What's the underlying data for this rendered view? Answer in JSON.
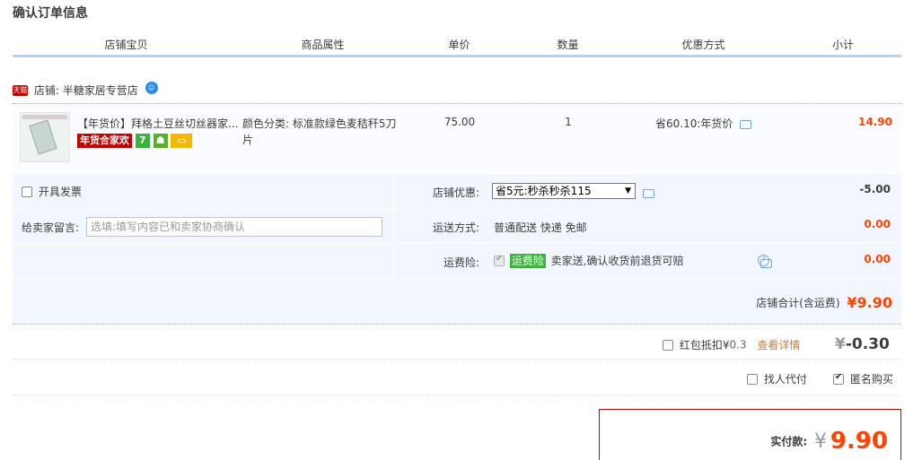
{
  "page_title": "确认订单信息",
  "columns": [
    "店铺宝贝",
    "商品属性",
    "单价",
    "数量",
    "优惠方式",
    "小计"
  ],
  "shop": {
    "tmall_badge": "天猫",
    "label": "店铺:",
    "name": "半糖家居专营店"
  },
  "item": {
    "title": "【年货价】拜格土豆丝切丝器家...",
    "badge_text": "年货合家欢",
    "badge_seven": "7",
    "attr_line1": "颜色分类: 标准款绿色麦秸秆5刀",
    "attr_line2": "片",
    "unit_price": "75.00",
    "quantity": "1",
    "discount": "省60.10:年货价",
    "subtotal": "14.90"
  },
  "invoice": {
    "label": "开具发票"
  },
  "memo": {
    "label": "给卖家留言:",
    "placeholder": "选填:填写内容已和卖家协商确认"
  },
  "shop_discount": {
    "label": "店铺优惠:",
    "selected": "省5元:秒杀秒杀115",
    "amount": "-5.00"
  },
  "shipping": {
    "label": "运送方式:",
    "value": "普通配送 快递 免邮",
    "amount": "0.00"
  },
  "insurance": {
    "label": "运费险:",
    "tag": "运费险",
    "desc": "卖家送,确认收货前退货可赔",
    "amount": "0.00"
  },
  "shop_total": {
    "label": "店铺合计(含运费)",
    "value": "¥9.90"
  },
  "red_packet": {
    "label": "红包抵扣¥",
    "value": "0.3",
    "link": "查看详情",
    "yen": "¥",
    "amount": "-0.30"
  },
  "options": {
    "proxy_pay": "找人代付",
    "anonymous": "匿名购买"
  },
  "payment": {
    "label": "实付款:",
    "yen": "¥",
    "amount": "9.90"
  },
  "colors": {
    "accent_red": "#ff4400",
    "tmall_red": "#c40000",
    "header_border": "#b2d1ff",
    "panel_bg": "#f2f7ff"
  }
}
